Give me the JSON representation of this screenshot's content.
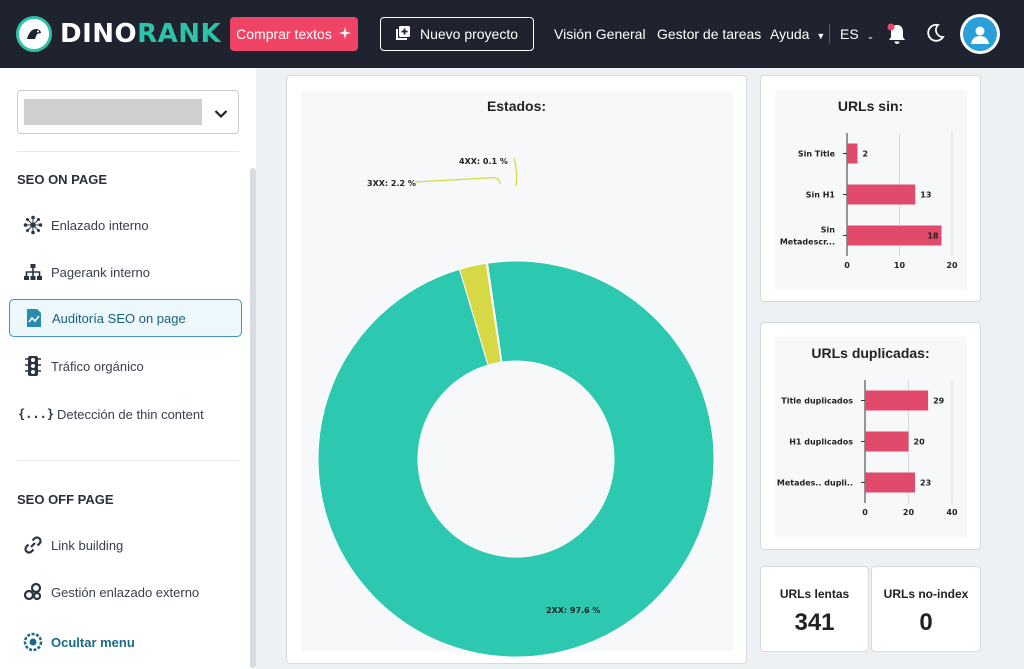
{
  "brand": {
    "name_a": "DINO",
    "name_b": "RANK",
    "accent": "#2cc3a8"
  },
  "header": {
    "buy_label": "Comprar textos",
    "new_project_label": "Nuevo proyecto",
    "nav": [
      "Visión General",
      "Gestor de tareas",
      "Ayuda"
    ],
    "lang": "ES",
    "icons": [
      "bell-icon",
      "moon-icon",
      "user-icon"
    ]
  },
  "sidebar": {
    "project_placeholder": "",
    "section_on": "SEO ON PAGE",
    "on_items": [
      {
        "label": "Enlazado interno",
        "icon": "network-icon"
      },
      {
        "label": "Pagerank interno",
        "icon": "sitemap-icon"
      },
      {
        "label": "Auditoría SEO on page",
        "icon": "audit-icon"
      },
      {
        "label": "Tráfico orgánico",
        "icon": "traffic-light-icon"
      },
      {
        "label": "Detección de thin content",
        "icon": "code-braces-icon"
      }
    ],
    "section_off": "SEO OFF PAGE",
    "off_items": [
      {
        "label": "Link building",
        "icon": "link-icon"
      },
      {
        "label": "Gestión enlazado externo",
        "icon": "links-icon"
      }
    ],
    "hide_label": "Ocultar menu"
  },
  "estados": {
    "title": "Estados:",
    "chart_data": {
      "type": "pie",
      "title": "Estados:",
      "categories": [
        "2XX",
        "3XX",
        "4XX"
      ],
      "values": [
        97.6,
        2.2,
        0.1
      ],
      "labels": [
        "2XX: 97.6 %",
        "3XX: 2.2 %",
        "4XX: 0.1 %"
      ],
      "colors": [
        "#2cc8b0",
        "#d6d945",
        "#d6d945"
      ]
    }
  },
  "urls_sin": {
    "title": "URLs sin:",
    "chart_data": {
      "type": "bar",
      "title": "URLs sin:",
      "categories": [
        "Sin Title",
        "Sin H1",
        "Sin Metadescr..."
      ],
      "values": [
        2,
        13,
        18
      ],
      "xlim": [
        0,
        20
      ],
      "ticks": [
        "0",
        "10",
        "20"
      ],
      "color": "#e24a6c"
    }
  },
  "urls_dup": {
    "title": "URLs duplicadas:",
    "chart_data": {
      "type": "bar",
      "title": "URLs duplicadas:",
      "categories": [
        "Title duplicados",
        "H1 duplicados",
        "Metades.. dupli.."
      ],
      "values": [
        29,
        20,
        23
      ],
      "xlim": [
        0,
        40
      ],
      "ticks": [
        "0",
        "20",
        "40"
      ],
      "color": "#e24a6c"
    }
  },
  "stats": {
    "slow_label": "URLs lentas",
    "slow_value": "341",
    "noindex_label": "URLs no-index",
    "noindex_value": "0"
  }
}
